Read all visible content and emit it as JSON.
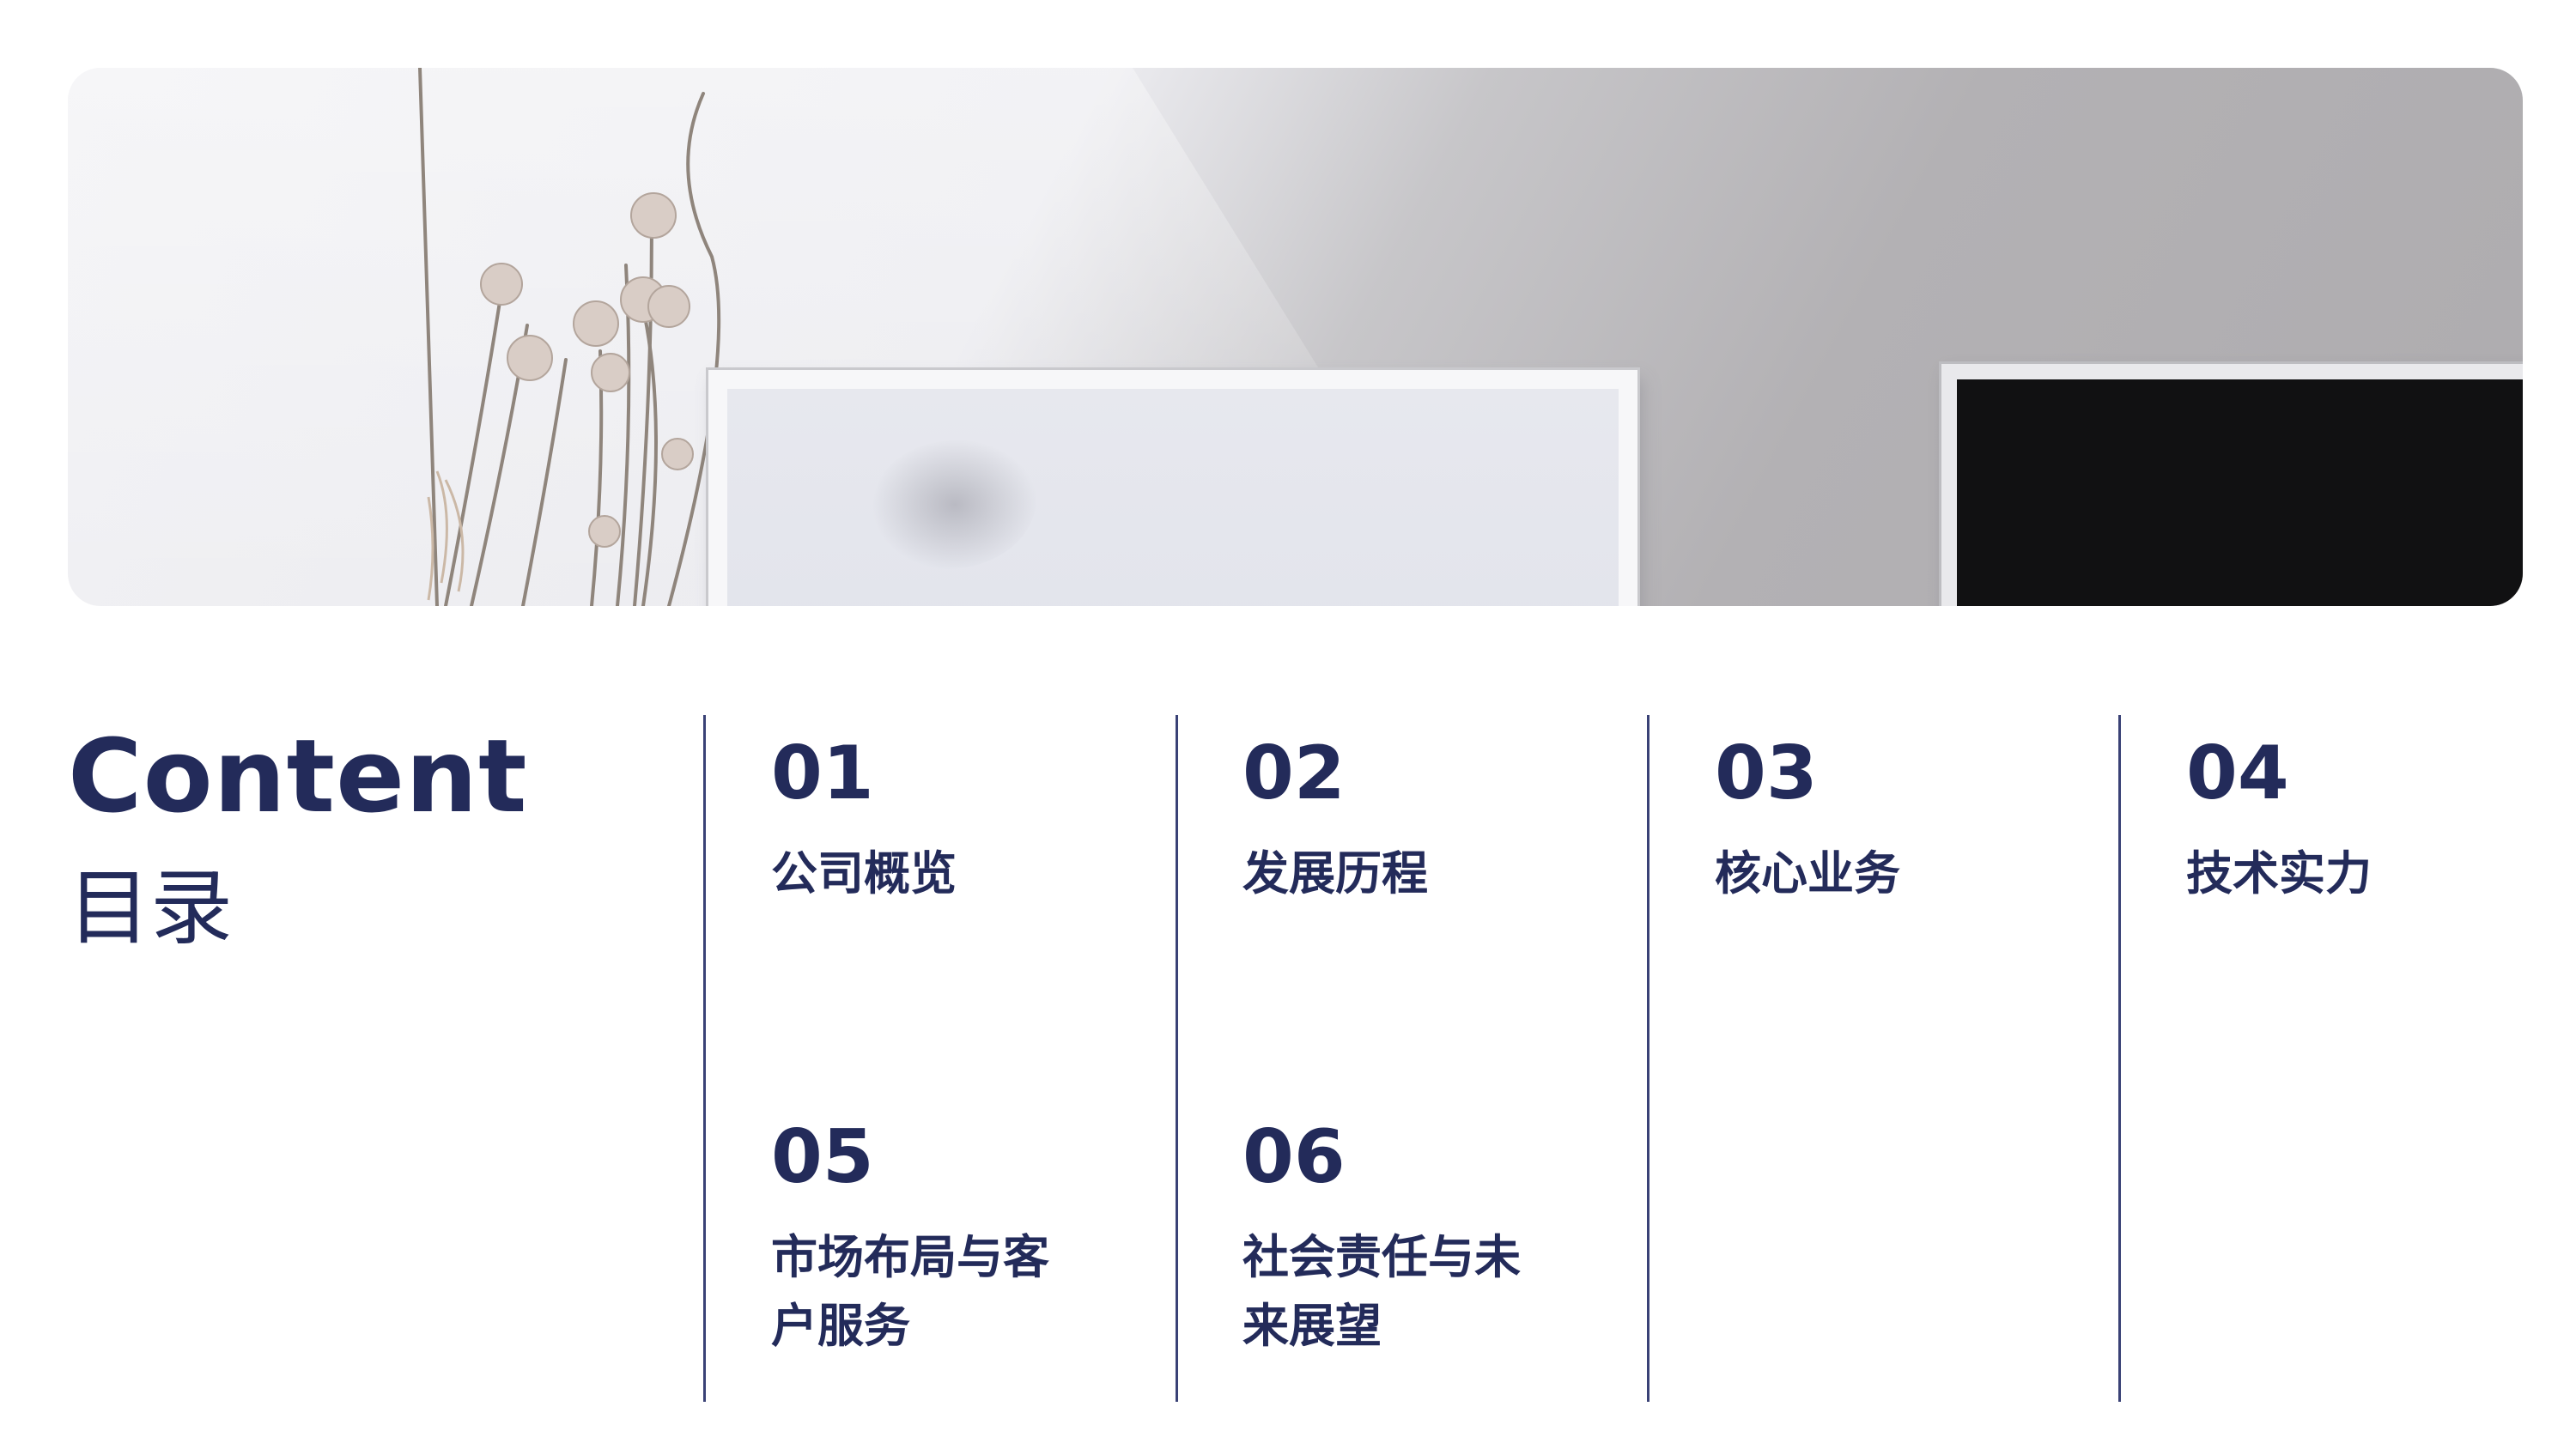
{
  "hero": {
    "image_description_icon": "interior-photo"
  },
  "title": {
    "english": "Content",
    "chinese": "目录"
  },
  "items": [
    {
      "number": "01",
      "label": "公司概览"
    },
    {
      "number": "02",
      "label": "发展历程"
    },
    {
      "number": "03",
      "label": "核心业务"
    },
    {
      "number": "04",
      "label": "技术实力"
    },
    {
      "number": "05",
      "label": "市场布局与客户服务"
    },
    {
      "number": "06",
      "label": "社会责任与未来展望"
    }
  ],
  "colors": {
    "accent": "#232b5a",
    "divider": "#3a4276",
    "background": "#ffffff"
  }
}
